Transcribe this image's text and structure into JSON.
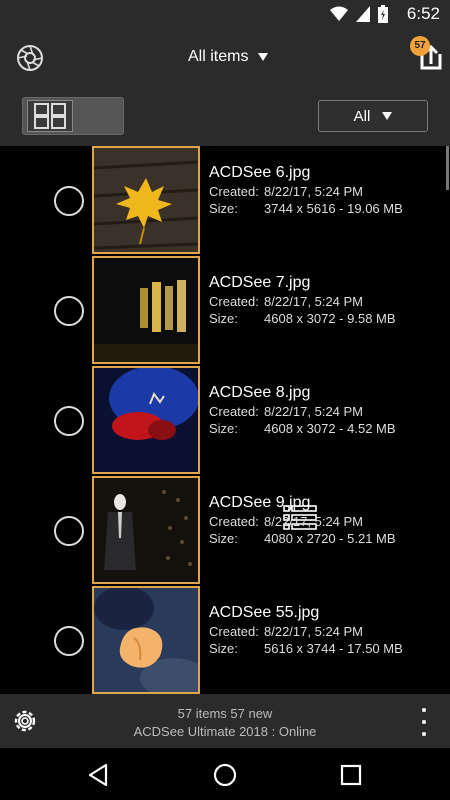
{
  "status_bar": {
    "time": "6:52"
  },
  "app_bar": {
    "title": "All items",
    "upload_badge": "57"
  },
  "toolbar": {
    "filter_label": "All"
  },
  "items": [
    {
      "name": "ACDSee 6.jpg",
      "created_label": "Created:",
      "created": "8/22/17, 5:24 PM",
      "size_label": "Size:",
      "size": "3744 x 5616 - 19.06 MB"
    },
    {
      "name": "ACDSee 7.jpg",
      "created_label": "Created:",
      "created": "8/22/17, 5:24 PM",
      "size_label": "Size:",
      "size": "4608 x 3072 - 9.58 MB"
    },
    {
      "name": "ACDSee 8.jpg",
      "created_label": "Created:",
      "created": "8/22/17, 5:24 PM",
      "size_label": "Size:",
      "size": "4608 x 3072 - 4.52 MB"
    },
    {
      "name": "ACDSee 9.jpg",
      "created_label": "Created:",
      "created": "8/22/17, 5:24 PM",
      "size_label": "Size:",
      "size": "4080 x 2720 - 5.21 MB"
    },
    {
      "name": "ACDSee 55.jpg",
      "created_label": "Created:",
      "created": "8/22/17, 5:24 PM",
      "size_label": "Size:",
      "size": "5616 x 3744 - 17.50 MB"
    }
  ],
  "footer": {
    "summary_line1": "57 items  57 new",
    "summary_line2": "ACDSee Ultimate 2018 : Online"
  },
  "colors": {
    "accent": "#f0a23a",
    "thumb_border": "#e0a44a",
    "bar_bg": "#2b2b2b"
  }
}
